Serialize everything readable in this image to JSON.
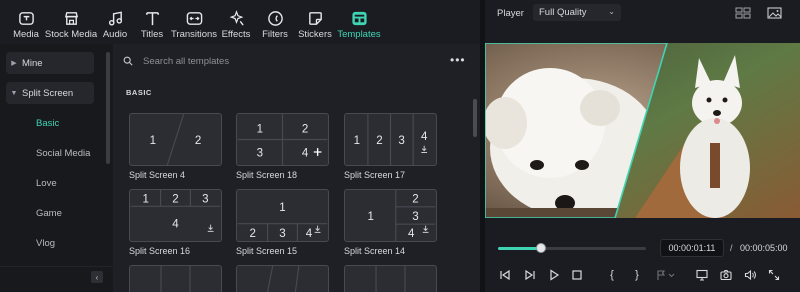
{
  "toolbar": {
    "items": [
      {
        "label": "Media",
        "icon": "media-icon"
      },
      {
        "label": "Stock Media",
        "icon": "stock-media-icon"
      },
      {
        "label": "Audio",
        "icon": "audio-icon"
      },
      {
        "label": "Titles",
        "icon": "titles-icon"
      },
      {
        "label": "Transitions",
        "icon": "transitions-icon"
      },
      {
        "label": "Effects",
        "icon": "effects-icon"
      },
      {
        "label": "Filters",
        "icon": "filters-icon"
      },
      {
        "label": "Stickers",
        "icon": "stickers-icon"
      },
      {
        "label": "Templates",
        "icon": "templates-icon"
      }
    ],
    "active": "Templates"
  },
  "sidebar": {
    "folders": [
      {
        "label": "Mine",
        "expanded": false
      },
      {
        "label": "Split Screen",
        "expanded": true
      }
    ],
    "subitems": [
      "Basic",
      "Social Media",
      "Love",
      "Game",
      "Vlog"
    ],
    "active_subitem": "Basic"
  },
  "panel": {
    "search_placeholder": "Search all templates",
    "section": "BASIC",
    "templates": [
      {
        "name": "Split Screen 4",
        "numbers": [
          "1",
          "2"
        ]
      },
      {
        "name": "Split Screen 18",
        "numbers": [
          "1",
          "2",
          "3",
          "4"
        ]
      },
      {
        "name": "Split Screen 17",
        "numbers": [
          "1",
          "2",
          "3",
          "4"
        ]
      },
      {
        "name": "Split Screen 16",
        "numbers": [
          "1",
          "2",
          "3",
          "4"
        ]
      },
      {
        "name": "Split Screen 15",
        "numbers": [
          "1",
          "2",
          "3",
          "4"
        ]
      },
      {
        "name": "Split Screen 14",
        "numbers": [
          "1",
          "2",
          "3",
          "4"
        ]
      }
    ]
  },
  "player": {
    "label": "Player",
    "quality": "Full Quality",
    "current_time": "00:00:01:11",
    "separator": "/",
    "total_time": "00:00:05:00",
    "progress": 0.29
  },
  "colors": {
    "accent": "#3fd4b4",
    "background": "#111216",
    "panel": "#1f2025"
  }
}
